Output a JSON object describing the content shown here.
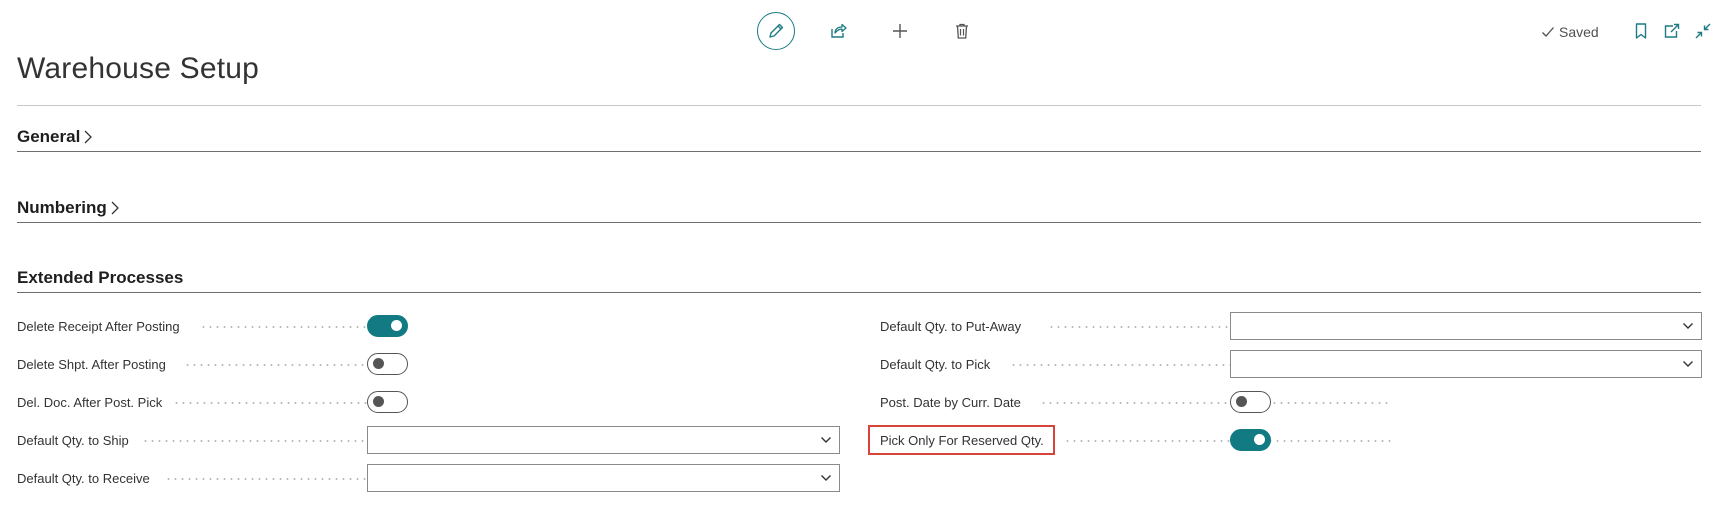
{
  "header": {
    "saved_label": "Saved"
  },
  "page": {
    "title": "Warehouse Setup"
  },
  "sections": {
    "general": "General",
    "numbering": "Numbering",
    "extended": "Extended Processes"
  },
  "fields": {
    "delete_receipt_after_posting": {
      "label": "Delete Receipt After Posting",
      "value": true
    },
    "delete_shpt_after_posting": {
      "label": "Delete Shpt. After Posting",
      "value": false
    },
    "del_doc_after_post_pick": {
      "label": "Del. Doc. After Post. Pick",
      "value": false
    },
    "default_qty_to_ship": {
      "label": "Default Qty. to Ship",
      "value": ""
    },
    "default_qty_to_receive": {
      "label": "Default Qty. to Receive",
      "value": ""
    },
    "default_qty_to_put_away": {
      "label": "Default Qty. to Put-Away",
      "value": ""
    },
    "default_qty_to_pick": {
      "label": "Default Qty. to Pick",
      "value": ""
    },
    "post_date_by_curr_date": {
      "label": "Post. Date by Curr. Date",
      "value": false
    },
    "pick_only_for_reserved_qty": {
      "label": "Pick Only For Reserved Qty.",
      "value": true
    }
  },
  "colors": {
    "accent": "#127a82",
    "highlight": "#d9443a"
  },
  "icons": {
    "edit": "pencil-icon",
    "share": "share-icon",
    "new": "plus-icon",
    "delete": "trash-icon",
    "bookmark": "bookmark-icon",
    "open_new_window": "open-new-window-icon",
    "collapse": "collapse-icon"
  }
}
